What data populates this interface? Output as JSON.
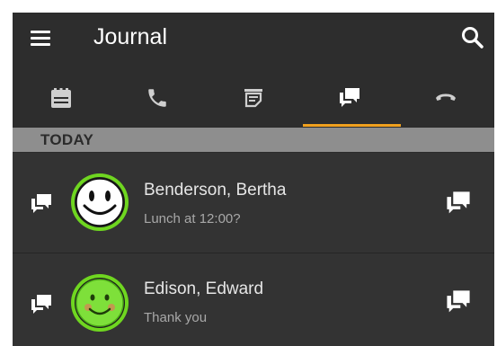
{
  "toolbar": {
    "title": "Journal",
    "menu_icon": "menu-icon",
    "search_icon": "search-icon"
  },
  "tabs": [
    {
      "icon": "calendar-icon",
      "selected": false
    },
    {
      "icon": "phone-icon",
      "selected": false
    },
    {
      "icon": "notes-icon",
      "selected": false
    },
    {
      "icon": "chat-icon",
      "selected": true
    },
    {
      "icon": "hangup-icon",
      "selected": false
    }
  ],
  "section": {
    "header": "TODAY"
  },
  "entries": [
    {
      "name": "Benderson, Bertha",
      "preview": "Lunch at 12:00?",
      "avatar": "white-smiley-avatar",
      "icon": "chat-icon"
    },
    {
      "name": "Edison, Edward",
      "preview": "Thank you",
      "avatar": "green-smiley-avatar",
      "icon": "chat-icon"
    }
  ],
  "colors": {
    "background": "#2d2d2d",
    "row": "#333333",
    "section_header": "#8e8e8e",
    "accent": "#f0a01e",
    "avatar_ring": "#6fd620",
    "icon": "#ffffff",
    "icon_muted": "#cfcfcf"
  }
}
